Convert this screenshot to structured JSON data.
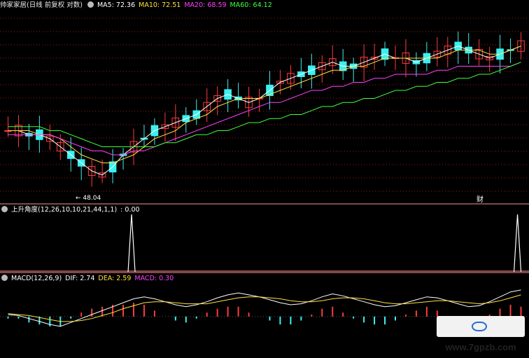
{
  "main_panel": {
    "title": "帅家家居(日线 前复权 对数)",
    "ma5": "MA5: 72.36",
    "ma10": "MA10: 72.51",
    "ma20": "MA20: 68.59",
    "ma60": "MA60: 64.12",
    "low_label": "48.04",
    "finance_badge": "财"
  },
  "indicator_panel": {
    "title": "上升角度(12,26,10,10,21,44,1,1)",
    "value": ": 0.00"
  },
  "macd_panel": {
    "title": "MACD(12,26,9)",
    "dif": "DIF: 2.74",
    "dea": "DEA: 2.59",
    "macd": "MACD: 0.30"
  },
  "watermark": "www.7gpzb.com",
  "colors": {
    "up": "#ff3b3b",
    "down": "#3cf0f0",
    "ma5": "#ffffff",
    "ma10": "#ffe040",
    "ma20": "#ff40ff",
    "ma60": "#40ff40",
    "grid": "#a01818",
    "divider": "#ff9090"
  },
  "chart_data": {
    "type": "candlestick",
    "series": [
      {
        "name": "MA5",
        "values": [
          62,
          62,
          61,
          61,
          60,
          58,
          56,
          54,
          52,
          51,
          53,
          56,
          58,
          60,
          62,
          63,
          64,
          65,
          66,
          68,
          70,
          71,
          70,
          69,
          70,
          72,
          74,
          75,
          76,
          77,
          78,
          79,
          78,
          78,
          79,
          80,
          81,
          80,
          80,
          79,
          80,
          81,
          82,
          83,
          82,
          81,
          80,
          81,
          82,
          83
        ]
      },
      {
        "name": "MA10",
        "values": [
          62,
          62,
          62,
          61,
          61,
          60,
          58,
          56,
          55,
          54,
          54,
          55,
          56,
          58,
          60,
          61,
          62,
          64,
          65,
          66,
          68,
          69,
          70,
          70,
          70,
          71,
          72,
          73,
          74,
          75,
          76,
          77,
          77,
          78,
          78,
          79,
          80,
          80,
          80,
          80,
          80,
          80,
          81,
          82,
          82,
          82,
          81,
          81,
          82,
          83
        ]
      },
      {
        "name": "MA20",
        "values": [
          61,
          61,
          61,
          61,
          61,
          60,
          59,
          58,
          57,
          57,
          56,
          56,
          57,
          57,
          58,
          59,
          60,
          61,
          62,
          63,
          64,
          65,
          66,
          67,
          68,
          69,
          69,
          70,
          71,
          72,
          72,
          73,
          73,
          74,
          74,
          75,
          75,
          76,
          76,
          76,
          76,
          77,
          77,
          78,
          78,
          78,
          78,
          78,
          78,
          79
        ]
      },
      {
        "name": "MA60",
        "values": [
          63,
          63,
          63,
          63,
          62,
          62,
          61,
          60,
          59,
          58,
          58,
          58,
          58,
          58,
          58,
          59,
          59,
          60,
          61,
          61,
          62,
          62,
          63,
          64,
          64,
          65,
          65,
          66,
          66,
          67,
          68,
          68,
          69,
          69,
          70,
          70,
          71,
          72,
          72,
          73,
          73,
          74,
          74,
          75,
          75,
          76,
          76,
          77,
          78,
          79
        ]
      }
    ],
    "indicator_spikes_at": [
      11,
      48
    ],
    "macd": {
      "dif": [
        0.2,
        0.1,
        -0.2,
        -0.5,
        -0.8,
        -1.0,
        -0.6,
        -0.2,
        0.2,
        0.6,
        1.0,
        1.4,
        1.8,
        2.0,
        1.8,
        1.5,
        1.2,
        1.0,
        1.2,
        1.5,
        1.9,
        2.2,
        2.4,
        2.2,
        2.0,
        1.7,
        1.4,
        1.2,
        1.3,
        1.6,
        2.0,
        2.3,
        2.1,
        1.8,
        1.5,
        1.2,
        1.0,
        1.1,
        1.4,
        1.7,
        2.0,
        1.9,
        1.6,
        1.3,
        1.0,
        1.1,
        1.5,
        2.0,
        2.5,
        2.7
      ],
      "dea": [
        0.3,
        0.2,
        0.1,
        -0.1,
        -0.3,
        -0.5,
        -0.5,
        -0.4,
        -0.2,
        0.1,
        0.4,
        0.8,
        1.1,
        1.4,
        1.5,
        1.5,
        1.4,
        1.3,
        1.3,
        1.3,
        1.5,
        1.7,
        1.9,
        2.0,
        2.0,
        1.9,
        1.8,
        1.6,
        1.5,
        1.5,
        1.6,
        1.8,
        1.9,
        1.9,
        1.8,
        1.6,
        1.4,
        1.3,
        1.3,
        1.4,
        1.5,
        1.6,
        1.6,
        1.5,
        1.4,
        1.3,
        1.4,
        1.6,
        1.9,
        2.2
      ]
    }
  }
}
